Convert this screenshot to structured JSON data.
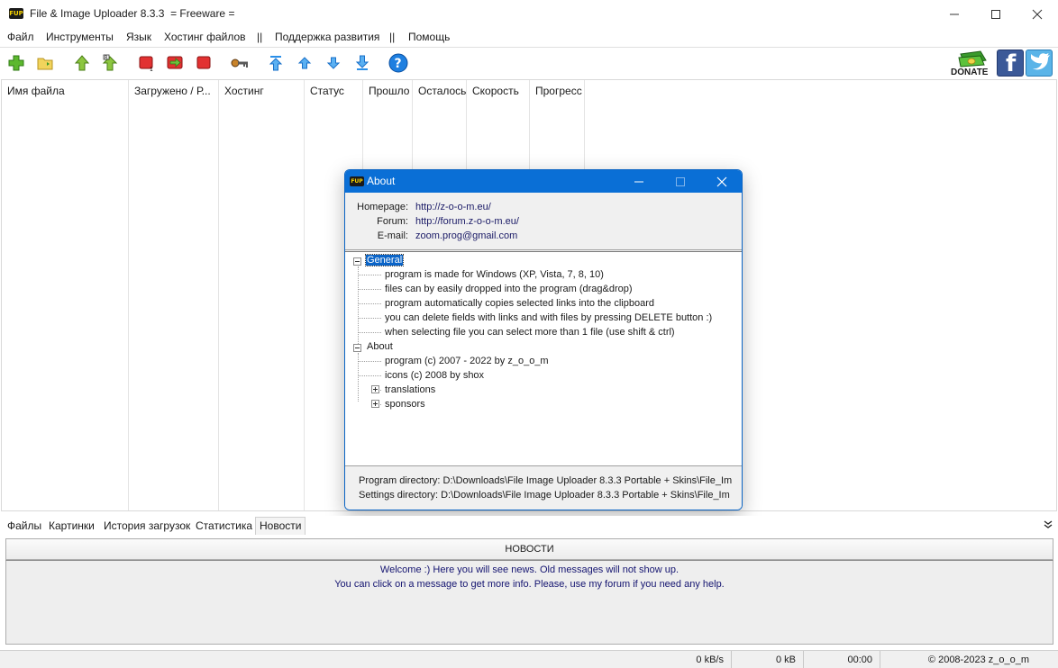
{
  "window": {
    "title": "File & Image Uploader 8.3.3  = Freeware =",
    "logo_text": "FUP"
  },
  "menu": {
    "items": [
      "Файл",
      "Инструменты",
      "Язык",
      "Хостинг файлов",
      "||",
      "Поддержка развития",
      "||",
      "Помощь"
    ]
  },
  "toolbar": {
    "icons": [
      "add-icon",
      "open-folder-icon",
      "upload-icon",
      "upload-all-icon",
      "stop-icon",
      "next-icon",
      "stop-all-icon",
      "keys-icon",
      "move-top-icon",
      "move-up-icon",
      "move-down-icon",
      "move-bottom-icon",
      "help-icon"
    ],
    "donate_label": "DONATE",
    "facebook_label": "f"
  },
  "filelist": {
    "columns": [
      "Имя файла",
      "Загружено / Р...",
      "Хостинг",
      "Статус",
      "Прошло",
      "Осталось",
      "Скорость",
      "Прогресс"
    ]
  },
  "about": {
    "title": "About",
    "logo_text": "FUP",
    "info": [
      {
        "label": "Homepage:",
        "value": "http://z-o-o-m.eu/"
      },
      {
        "label": "Forum:",
        "value": "http://forum.z-o-o-m.eu/"
      },
      {
        "label": "E-mail:",
        "value": "zoom.prog@gmail.com"
      }
    ],
    "tree": {
      "general": "General",
      "general_items": [
        "program is made for Windows (XP, Vista, 7, 8, 10)",
        "files can by easily dropped into the program (drag&drop)",
        "program automatically copies selected links into the clipboard",
        "you can delete fields with links and with files by pressing DELETE button :)",
        "when selecting file you can select more than 1 file (use shift & ctrl)"
      ],
      "about": "About",
      "about_items": [
        "program (c) 2007 - 2022 by z_o_o_m",
        "icons (c) 2008 by shox",
        "translations",
        "sponsors"
      ]
    },
    "program_dir": "Program directory: D:\\Downloads\\File  Image Uploader 8.3.3 Portable + Skins\\File_Im",
    "settings_dir": "Settings directory: D:\\Downloads\\File  Image Uploader 8.3.3 Portable + Skins\\File_Im"
  },
  "tabs": {
    "items": [
      "Файлы",
      "Картинки",
      "История загрузок",
      "Статистика",
      "Новости"
    ],
    "active": "Новости"
  },
  "news": {
    "header": "НОВОСТИ",
    "line1": "Welcome :) Here you will see news. Old messages will not show up.",
    "line2": "You can click on a message to get more info. Please, use my forum if you need any help."
  },
  "status": {
    "speed": "0 kB/s",
    "size": "0 kB",
    "time": "00:00",
    "copyright": "© 2008-2023 z_o_o_m"
  }
}
